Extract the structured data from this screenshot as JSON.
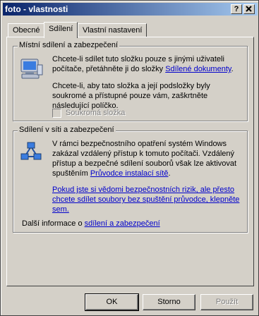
{
  "window": {
    "title": "foto - vlastnosti",
    "help_label": "?",
    "close_label": "x"
  },
  "tabs": [
    {
      "label": "Obecné"
    },
    {
      "label": "Sdílení"
    },
    {
      "label": "Vlastní nastavení"
    }
  ],
  "local_sharing": {
    "title": "Místní sdílení a zabezpečení",
    "para1_prefix": "Chcete-li sdílet tuto složku pouze s jinými uživateli počítače, přetáhněte ji do složky",
    "para1_link": "Sdílené dokumenty",
    "para1_suffix": ".",
    "para2": "Chcete-li, aby tato složka a její podsložky byly soukromé a přístupné pouze vám, zaškrtněte následující políčko.",
    "private_checkbox_label": "Soukromá složka"
  },
  "network_sharing": {
    "title": "Sdílení v síti a zabezpečení",
    "para1_prefix": "V rámci bezpečnostního opatření systém Windows zakázal vzdálený přístup k tomuto počítači. Vzdálený přístup a bezpečné sdílení souborů však lze aktivovat spuštěním",
    "para1_link": "Průvodce instalací sítě",
    "para1_suffix": ".",
    "risk_link": "Pokud jste si vědomi bezpečnostních rizik, ale přesto chcete sdílet soubory bez spuštění průvodce, klepněte sem.",
    "more_info_prefix": "Další informace o",
    "more_info_link": "sdílení a zabezpečení"
  },
  "buttons": {
    "ok": "OK",
    "cancel": "Storno",
    "apply": "Použít"
  }
}
